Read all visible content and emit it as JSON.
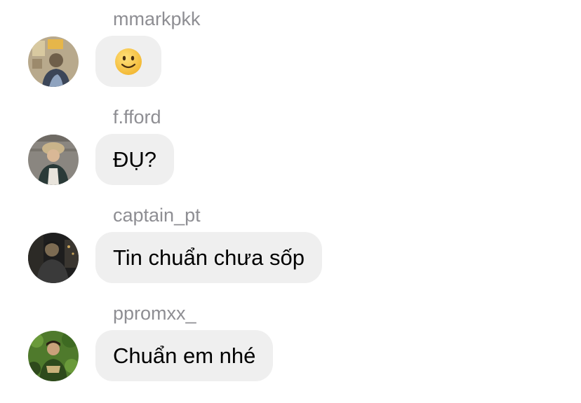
{
  "messages": [
    {
      "sender": "mmarkpkk",
      "text": "",
      "emoji": "slightly-smiling-face-icon",
      "avatar_colors": [
        "#b8a98c",
        "#6f5f4a",
        "#3c4658"
      ]
    },
    {
      "sender": "f.fford",
      "text": "ĐỤ?",
      "avatar_colors": [
        "#8a8680",
        "#c9b48a",
        "#2a3a38"
      ]
    },
    {
      "sender": "captain_pt",
      "text": "Tin chuẩn chưa sốp",
      "avatar_colors": [
        "#3a3a3a",
        "#1e1e1e",
        "#7c6b52"
      ]
    },
    {
      "sender": "ppromxx_",
      "text": "Chuẩn em nhé",
      "avatar_colors": [
        "#4f7a2c",
        "#2e4a1c",
        "#c9b27a"
      ]
    }
  ],
  "colors": {
    "bubble": "#efefef",
    "sender": "#8e8e93",
    "text": "#000000",
    "emoji_yellow": "#f7c843"
  }
}
